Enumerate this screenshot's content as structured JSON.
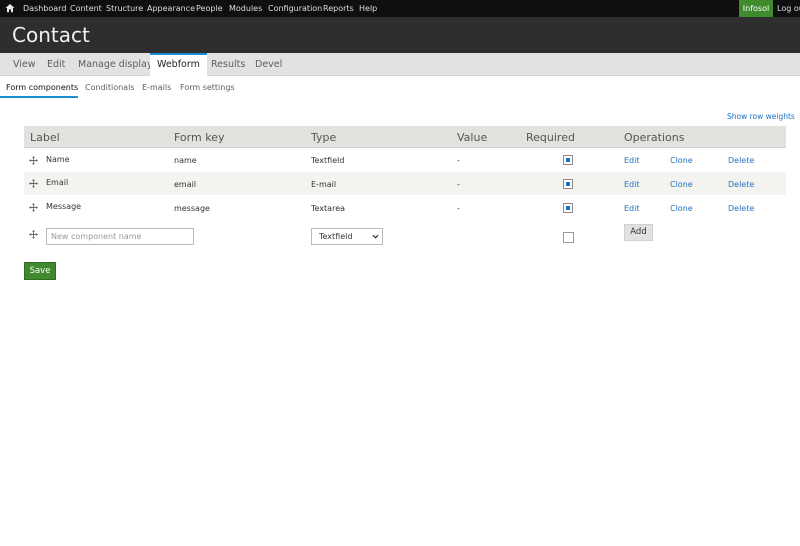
{
  "toolbar": {
    "items": [
      "Dashboard",
      "Content",
      "Structure",
      "Appearance",
      "People",
      "Modules",
      "Configuration",
      "Reports",
      "Help"
    ],
    "user": "Infosol",
    "logout": "Log out"
  },
  "page_title": "Contact",
  "primary_tabs": [
    "View",
    "Edit",
    "Manage display",
    "Webform",
    "Results",
    "Devel"
  ],
  "active_primary_tab": "Webform",
  "secondary_tabs": [
    "Form components",
    "Conditionals",
    "E-mails",
    "Form settings"
  ],
  "active_secondary_tab": "Form components",
  "show_row_weights": "Show row weights",
  "table": {
    "headers": [
      "Label",
      "Form key",
      "Type",
      "Value",
      "Required",
      "Operations"
    ],
    "rows": [
      {
        "label": "Name",
        "form_key": "name",
        "type": "Textfield",
        "value": "-",
        "required": true,
        "ops": [
          "Edit",
          "Clone",
          "Delete"
        ]
      },
      {
        "label": "Email",
        "form_key": "email",
        "type": "E-mail",
        "value": "-",
        "required": true,
        "ops": [
          "Edit",
          "Clone",
          "Delete"
        ]
      },
      {
        "label": "Message",
        "form_key": "message",
        "type": "Textarea",
        "value": "-",
        "required": true,
        "ops": [
          "Edit",
          "Clone",
          "Delete"
        ]
      }
    ],
    "new_row": {
      "name_placeholder": "New component name",
      "type_value": "Textfield",
      "required": false,
      "add_label": "Add"
    }
  },
  "save_label": "Save",
  "colors": {
    "toolbar_bg": "#0f0f0f",
    "header_bg": "#2e2e2e",
    "accent_blue": "#1c8fd4",
    "link_blue": "#1f73c4",
    "save_green": "#3e8a2d"
  }
}
